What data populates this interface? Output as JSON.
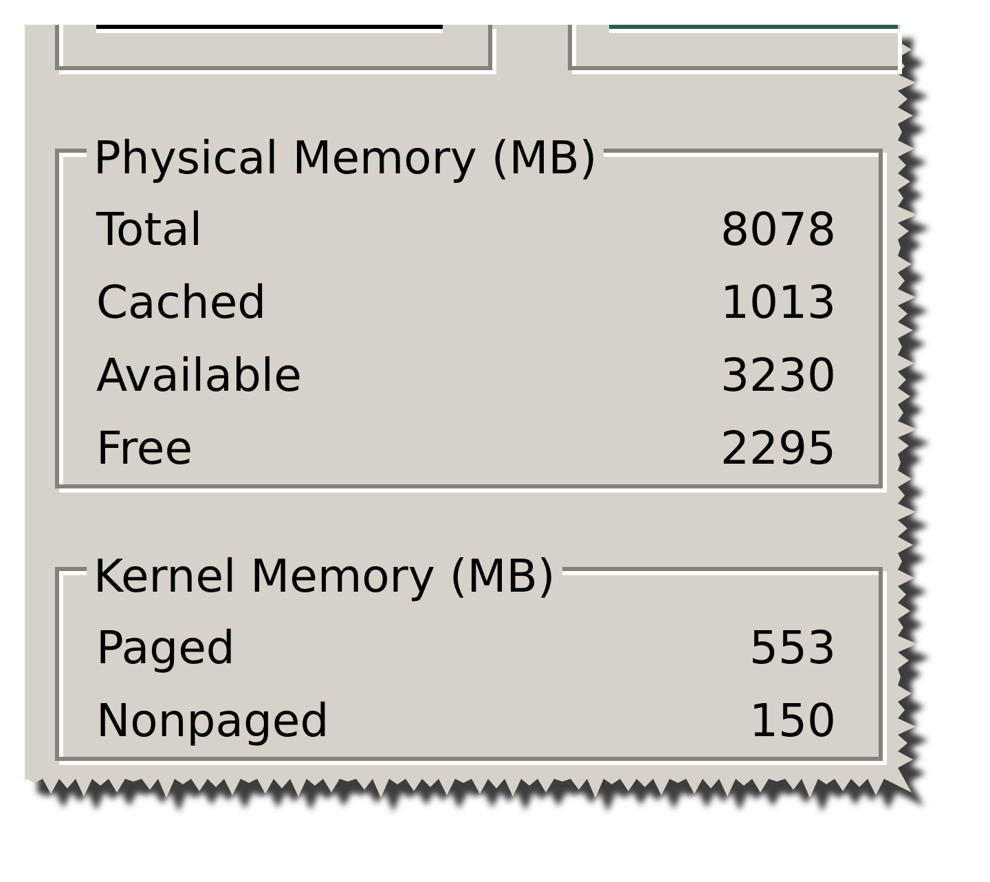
{
  "groups": [
    {
      "title": "Physical Memory (MB)",
      "rows": [
        {
          "label": "Total",
          "value": "8078"
        },
        {
          "label": "Cached",
          "value": "1013"
        },
        {
          "label": "Available",
          "value": "3230"
        },
        {
          "label": "Free",
          "value": "2295"
        }
      ]
    },
    {
      "title": "Kernel Memory (MB)",
      "rows": [
        {
          "label": "Paged",
          "value": "553"
        },
        {
          "label": "Nonpaged",
          "value": "150"
        }
      ]
    }
  ]
}
